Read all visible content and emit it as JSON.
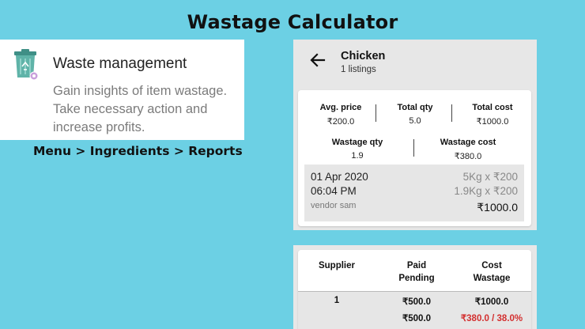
{
  "page_title": "Wastage Calculator",
  "info": {
    "heading": "Waste management",
    "body": "Gain insights of item wastage. Take necessary action and increase profits."
  },
  "breadcrumb": "Menu > Ingredients > Reports",
  "detail": {
    "title": "Chicken",
    "subtitle": "1 listings",
    "stats": {
      "avg_price_label": "Avg. price",
      "avg_price": "₹200.0",
      "total_qty_label": "Total qty",
      "total_qty": "5.0",
      "total_cost_label": "Total cost",
      "total_cost": "₹1000.0",
      "wastage_qty_label": "Wastage qty",
      "wastage_qty": "1.9",
      "wastage_cost_label": "Wastage cost",
      "wastage_cost": "₹380.0"
    },
    "entry": {
      "date": "01 Apr 2020",
      "time": "06:04 PM",
      "vendor": "vendor sam",
      "qty_line": "5Kg x ₹200",
      "waste_line": "1.9Kg x ₹200",
      "total": "₹1000.0"
    }
  },
  "table": {
    "headers": {
      "supplier": "Supplier",
      "paid": "Paid",
      "pending": "Pending",
      "cost": "Cost",
      "wastage": "Wastage"
    },
    "row": {
      "supplier": "1",
      "paid": "₹500.0",
      "pending": "₹500.0",
      "cost": "₹1000.0",
      "wastage": "₹380.0 / 38.0%"
    }
  },
  "colors": {
    "background": "#6cd0e4",
    "wastage_red": "#d32f2f",
    "bin_teal": "#5fb3a8"
  },
  "icons": {
    "info": "recycle-bin-icon",
    "back": "back-arrow-icon"
  }
}
